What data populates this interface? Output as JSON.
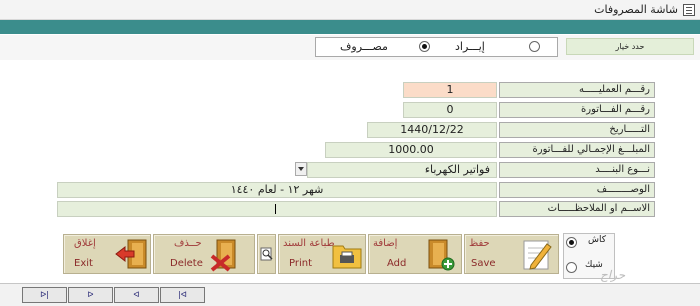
{
  "window": {
    "title": "شاشة المصروفات"
  },
  "options": {
    "choose_label": "حدد خيار",
    "revenue_label": "إيـــراد",
    "expense_label": "مصـــروف",
    "selected": "مصـــروف"
  },
  "form": {
    "operation_no": {
      "label": "رقـــم العمليـــــه",
      "value": "1"
    },
    "invoice_no": {
      "label": "رقـــم الفـــاتورة",
      "value": "0"
    },
    "date": {
      "label": "التـــــاريخ",
      "value": "1440/12/22"
    },
    "total": {
      "label": "المبلـــغ الإجمـالي للفـــاتورة",
      "value": "1000.00"
    },
    "item_type": {
      "label": "نـــوع البنــــد",
      "value": "فواتير الكهرباء"
    },
    "description": {
      "label": "الوصــــــــف",
      "value": "شهر ١٢ - لعام ١٤٤٠"
    },
    "notes": {
      "label": "الاســم او الملاحظـــــات",
      "value": ""
    }
  },
  "payment": {
    "cash": "كاش",
    "check": "شيك"
  },
  "buttons": {
    "save": {
      "ar": "حفظ",
      "en": "Save"
    },
    "add": {
      "ar": "إضافة",
      "en": "Add"
    },
    "print": {
      "ar": "طباعة السند",
      "en": "Print"
    },
    "delete": {
      "ar": "حــذف",
      "en": "Delete"
    },
    "exit": {
      "ar": "إغلاق",
      "en": "Exit"
    }
  },
  "nav": {
    "first": "ᐅ|",
    "next": "ᐅ",
    "prev": "ᐊ",
    "last": "|ᐊ"
  },
  "watermark": "حراج",
  "colors": {
    "teal": "#3b8d8c",
    "label_green": "#e6efdc",
    "peach": "#fbdcc8",
    "button_tan": "#ddd7b7",
    "nav_blue": "#1b1b6e"
  }
}
